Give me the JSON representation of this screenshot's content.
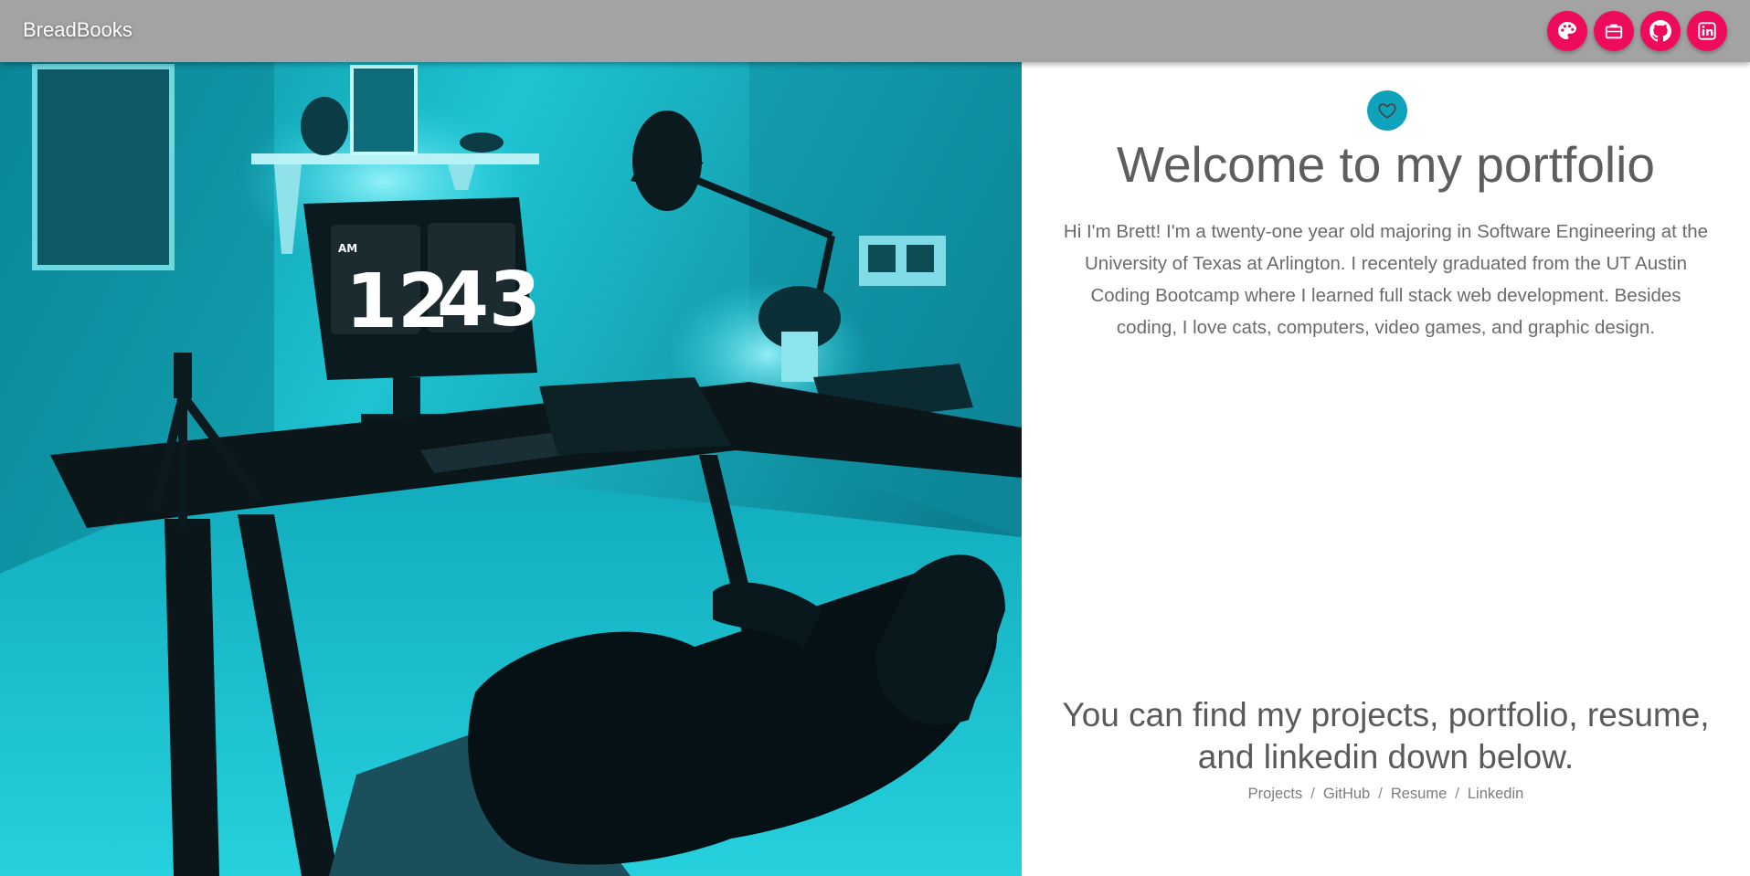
{
  "navbar": {
    "brand": "BreadBooks",
    "buttons": [
      {
        "icon": "palette-icon",
        "color": "#ee0b5c"
      },
      {
        "icon": "briefcase-icon",
        "color": "#ee0b5c"
      },
      {
        "icon": "github-icon",
        "color": "#ee0b5c"
      },
      {
        "icon": "linkedin-icon",
        "color": "#ee0b5c"
      }
    ]
  },
  "hero": {
    "clock_period": "AM",
    "clock_hour": "12",
    "clock_minute": "43"
  },
  "main": {
    "badge_icon": "heart-icon",
    "title": "Welcome to my portfolio",
    "intro": "Hi I'm Brett! I'm a twenty-one year old majoring in Software Engineering at the University of Texas at Arlington. I recentely graduated from the UT Austin Coding Bootcamp where I learned full stack web development. Besides coding, I love cats, computers, video games, and graphic design.",
    "find_text": "You can find my projects, portfolio, resume, and linkedin down below.",
    "links": {
      "projects": "Projects",
      "github": "GitHub",
      "resume": "Resume",
      "linkedin": "Linkedin",
      "separator": "/"
    }
  },
  "colors": {
    "navbar_bg": "#a3a3a3",
    "accent_pink": "#ee0b5c",
    "badge_teal": "#0fa3bb",
    "text_gray": "#5e5e5e"
  }
}
